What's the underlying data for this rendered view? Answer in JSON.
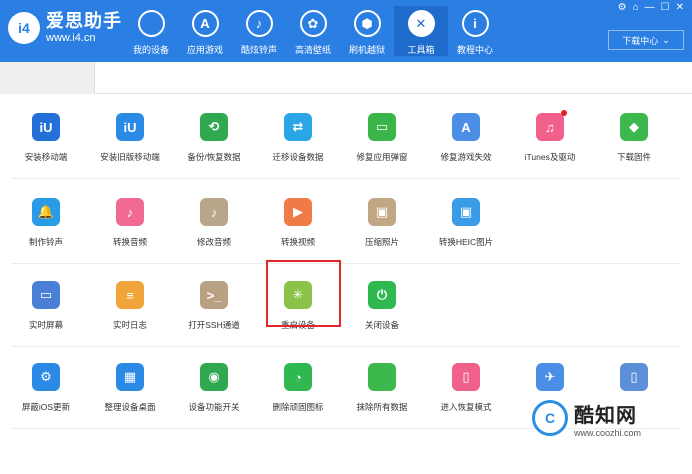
{
  "app": {
    "logo_mark": "i4",
    "name": "爱思助手",
    "url": "www.i4.cn"
  },
  "nav": [
    {
      "label": "我的设备",
      "icon": "apple-icon",
      "glyph": ""
    },
    {
      "label": "应用游戏",
      "icon": "app-store-icon",
      "glyph": "A"
    },
    {
      "label": "酷炫铃声",
      "icon": "bell-icon",
      "glyph": "♪"
    },
    {
      "label": "高清壁纸",
      "icon": "flower-icon",
      "glyph": "✿"
    },
    {
      "label": "刷机越狱",
      "icon": "box-icon",
      "glyph": "⬢"
    },
    {
      "label": "工具箱",
      "icon": "tools-icon",
      "glyph": "✕",
      "active": true
    },
    {
      "label": "教程中心",
      "icon": "info-icon",
      "glyph": "i"
    }
  ],
  "window_controls": [
    "⚙",
    "⌂",
    "—",
    "☐",
    "✕"
  ],
  "download_center": {
    "label": "下载中心",
    "icon": "chevron-down-icon"
  },
  "rows": [
    [
      {
        "label": "安装移动端",
        "color": "#2370d9",
        "glyph": "iU"
      },
      {
        "label": "安装旧版移动端",
        "color": "#2a8ae6",
        "glyph": "iU"
      },
      {
        "label": "备份/恢复数据",
        "color": "#2fa84f",
        "glyph": "⟲"
      },
      {
        "label": "迁移设备数据",
        "color": "#2aa5e6",
        "glyph": "⇄"
      },
      {
        "label": "修复应用弹窗",
        "color": "#39b54a",
        "glyph": "▭"
      },
      {
        "label": "修复游戏失效",
        "color": "#4a8ee6",
        "glyph": "A"
      },
      {
        "label": "iTunes及驱动",
        "color": "#f0608a",
        "glyph": "♫",
        "badge": true
      },
      {
        "label": "下载固件",
        "color": "#3db84c",
        "glyph": "◆"
      }
    ],
    [
      {
        "label": "制作铃声",
        "color": "#2a9be6",
        "glyph": "🔔"
      },
      {
        "label": "转换音频",
        "color": "#f06a92",
        "glyph": "♪"
      },
      {
        "label": "修改音频",
        "color": "#b9a58a",
        "glyph": "♪"
      },
      {
        "label": "转换视频",
        "color": "#f07a48",
        "glyph": "▶"
      },
      {
        "label": "压缩照片",
        "color": "#c2a784",
        "glyph": "▣"
      },
      {
        "label": "转换HEIC图片",
        "color": "#3a9be6",
        "glyph": "▣"
      }
    ],
    [
      {
        "label": "实时屏幕",
        "color": "#4a7fd6",
        "glyph": "▭"
      },
      {
        "label": "实时日志",
        "color": "#f0a43a",
        "glyph": "≡"
      },
      {
        "label": "打开SSH通道",
        "color": "#b9a283",
        "glyph": ">_"
      },
      {
        "label": "重启设备",
        "color": "#8bc34a",
        "glyph": "✳"
      },
      {
        "label": "关闭设备",
        "color": "#2fb84f",
        "glyph": "⏻"
      }
    ],
    [
      {
        "label": "屏蔽iOS更新",
        "color": "#2a8ae6",
        "glyph": "⚙"
      },
      {
        "label": "整理设备桌面",
        "color": "#2a8ae6",
        "glyph": "▦"
      },
      {
        "label": "设备功能开关",
        "color": "#2fa84f",
        "glyph": "◉"
      },
      {
        "label": "删除顽固图标",
        "color": "#2fb84f",
        "glyph": "◔"
      },
      {
        "label": "抹除所有数据",
        "color": "#3db84c",
        "glyph": ""
      },
      {
        "label": "进入恢复模式",
        "color": "#f0608a",
        "glyph": "▯"
      },
      {
        "label": "",
        "color": "#4a8ee6",
        "glyph": "✈"
      },
      {
        "label": "",
        "color": "#5b8fd8",
        "glyph": "▯"
      }
    ]
  ],
  "watermark": {
    "logo": "C",
    "name": "酷知网",
    "url": "www.coozhi.com"
  }
}
